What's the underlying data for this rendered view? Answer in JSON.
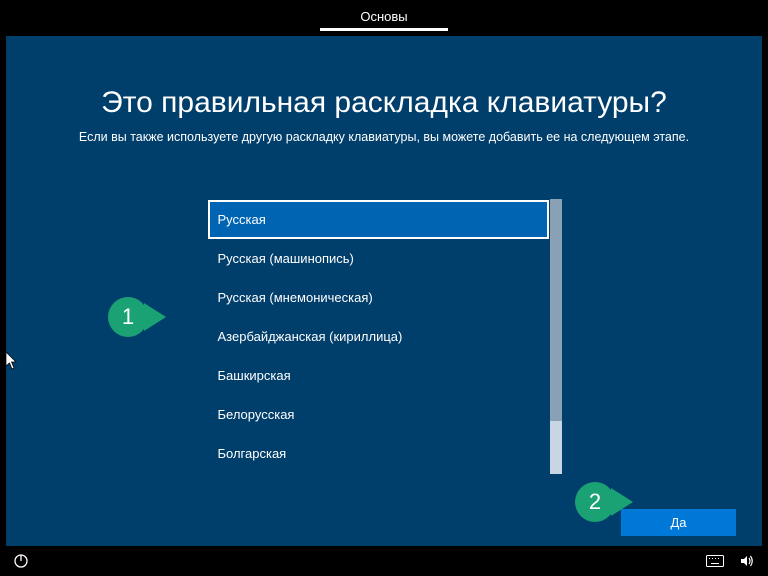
{
  "tab": {
    "label": "Основы"
  },
  "title": "Это правильная раскладка клавиатуры?",
  "subtitle": "Если вы также используете другую раскладку клавиатуры, вы можете добавить ее на следующем этапе.",
  "layouts": [
    "Русская",
    "Русская (машинопись)",
    "Русская (мнемоническая)",
    "Азербайджанская (кириллица)",
    "Башкирская",
    "Белорусская",
    "Болгарская"
  ],
  "selectedIndex": 0,
  "yesButton": "Да",
  "callouts": {
    "one": "1",
    "two": "2"
  }
}
